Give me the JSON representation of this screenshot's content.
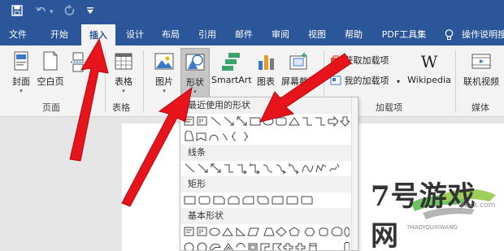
{
  "title_bar": {
    "save_icon": "save-icon",
    "undo_icon": "undo-icon",
    "redo_icon": "redo-icon",
    "customize_icon": "customize-quick-access-icon"
  },
  "tabs": [
    {
      "label": "文件"
    },
    {
      "label": "开始"
    },
    {
      "label": "插入",
      "active": true
    },
    {
      "label": "设计"
    },
    {
      "label": "布局"
    },
    {
      "label": "引用"
    },
    {
      "label": "邮件"
    },
    {
      "label": "审阅"
    },
    {
      "label": "视图"
    },
    {
      "label": "帮助"
    },
    {
      "label": "PDF工具集"
    },
    {
      "label": "操作说明搜"
    }
  ],
  "tell_me_icon": "lightbulb-icon",
  "ribbon": {
    "pages_group": {
      "label": "页面",
      "cover": "封面",
      "blank_page": "空白页"
    },
    "tables_group": {
      "label": "表格",
      "table": "表格"
    },
    "illustrations": {
      "picture": "图片",
      "shapes": "形状",
      "smartart": "SmartArt",
      "chart": "图表",
      "screenshot": "屏幕截图"
    },
    "addins_group": {
      "label": "加载项",
      "get_addins": "获取加载项",
      "my_addins": "我的加载项",
      "wikipedia": "Wikipedia",
      "wikipedia_glyph": "W"
    },
    "media_group": {
      "label": "媒体",
      "online_video": "联机视频"
    }
  },
  "shapes_dropdown": {
    "sections": [
      {
        "title": "最近使用的形状"
      },
      {
        "title": "线条"
      },
      {
        "title": "矩形"
      },
      {
        "title": "基本形状"
      }
    ]
  },
  "watermark": {
    "brand": "7号游戏网",
    "url": "jiaxx.com",
    "tagline": "7HAOYOUXIWANG"
  },
  "colors": {
    "ribbon_blue": "#2b579a",
    "arrow_red": "#e8141b"
  }
}
